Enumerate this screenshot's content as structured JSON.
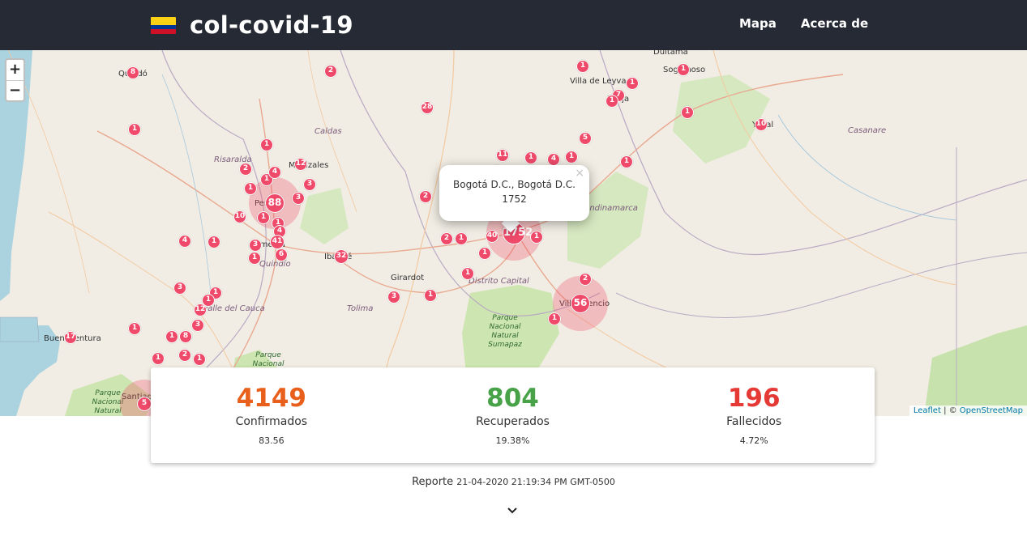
{
  "navbar": {
    "brand": "col-covid-19",
    "links": [
      "Mapa",
      "Acerca de"
    ],
    "flag_colors": [
      "#fcd116",
      "#003893",
      "#ce1126"
    ]
  },
  "map": {
    "zoom_in": "+",
    "zoom_out": "−",
    "popup": {
      "title": "Bogotá D.C., Bogotá D.C.",
      "value": "1752",
      "close": "×"
    },
    "attribution": {
      "leaflet": "Leaflet",
      "separator": " | © ",
      "osm": "OpenStreetMap"
    },
    "places": [
      "Quibdó",
      "Caldas",
      "Risaralda",
      "Manizales",
      "Pereira",
      "Armenia",
      "Quindío",
      "Ibagué",
      "Girardot",
      "Tolima",
      "Valle del Cauca",
      "Buenaventura",
      "Santiago de Cali",
      "Duitama",
      "Sogamoso",
      "Villa de Leyva",
      "Tunja",
      "Yopal",
      "Casanare",
      "Cundinamarca",
      "Distrito Capital",
      "Villavicencio",
      "Parque Nacional Natural Sumapaz",
      "Parque Nacional Natural",
      "Parque Nacional Natural"
    ],
    "marker_color": "#ef4a6a",
    "markers": [
      "8",
      "2",
      "1",
      "28",
      "1",
      "1",
      "1",
      "1",
      "7",
      "1",
      "1",
      "10",
      "1",
      "1",
      "5",
      "11",
      "1",
      "4",
      "1",
      "2",
      "1",
      "2",
      "12",
      "4",
      "1",
      "3",
      "88",
      "3",
      "10",
      "1",
      "1",
      "4",
      "4",
      "1",
      "3",
      "41",
      "1",
      "6",
      "32",
      "2",
      "1",
      "40",
      "1752",
      "1",
      "1",
      "1",
      "2",
      "56",
      "1",
      "3",
      "1",
      "1",
      "3",
      "12",
      "3",
      "1",
      "1",
      "8",
      "17",
      "1",
      "2",
      "1",
      "5",
      "1"
    ]
  },
  "stats": [
    {
      "value": "4149",
      "label": "Confirmados",
      "sub": "83.56",
      "color": "#e8601c"
    },
    {
      "value": "804",
      "label": "Recuperados",
      "sub": "19.38%",
      "color": "#47a248"
    },
    {
      "value": "196",
      "label": "Fallecidos",
      "sub": "4.72%",
      "color": "#e53935"
    }
  ],
  "report": {
    "label": "Reporte",
    "timestamp": "21-04-2020 21:19:34 PM GMT-0500"
  }
}
